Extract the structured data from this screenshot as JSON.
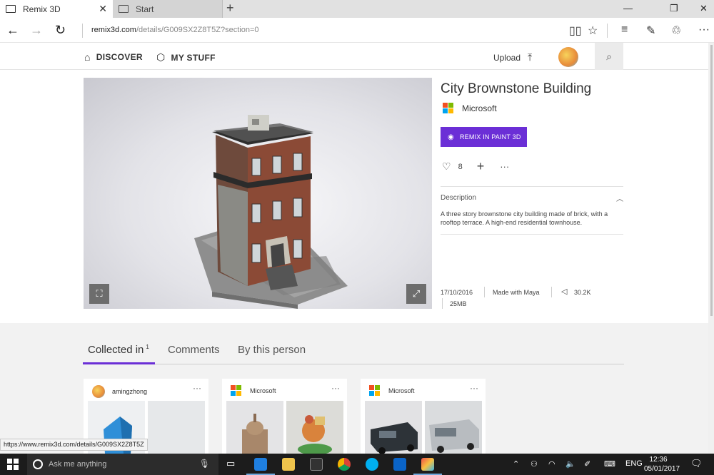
{
  "browser": {
    "tabs": [
      {
        "label": "Remix 3D",
        "active": true
      },
      {
        "label": "Start",
        "active": false
      }
    ],
    "url_host": "remix3d.com",
    "url_path": "/details/G009SX2Z8T5Z?section=0",
    "status_url": "https://www.remix3d.com/details/G009SX2Z8T5Z"
  },
  "site_nav": {
    "discover": "DISCOVER",
    "my_stuff": "MY STUFF",
    "upload": "Upload"
  },
  "model": {
    "title": "City Brownstone Building",
    "author": "Microsoft",
    "remix_button": "REMIX IN PAINT 3D",
    "likes": "8",
    "description_label": "Description",
    "description": "A three story brownstone city building made of brick, with a rooftop terrace. A high-end residential townhouse.",
    "date": "17/10/2016",
    "made_with": "Made with Maya",
    "triangles": "30.2K",
    "size": "25MB"
  },
  "lower_tabs": {
    "collected_in": "Collected in",
    "collected_count": "1",
    "comments": "Comments",
    "by_person": "By this person"
  },
  "cards": [
    {
      "author": "amingzhong",
      "more": "···"
    },
    {
      "author": "Microsoft",
      "more": "···"
    },
    {
      "author": "Microsoft",
      "more": "···"
    }
  ],
  "taskbar": {
    "search_placeholder": "Ask me anything",
    "language": "ENG",
    "time": "12:36",
    "date": "05/01/2017"
  },
  "colors": {
    "accent": "#6b2fd6",
    "taskbar": "#1c1c1c"
  }
}
